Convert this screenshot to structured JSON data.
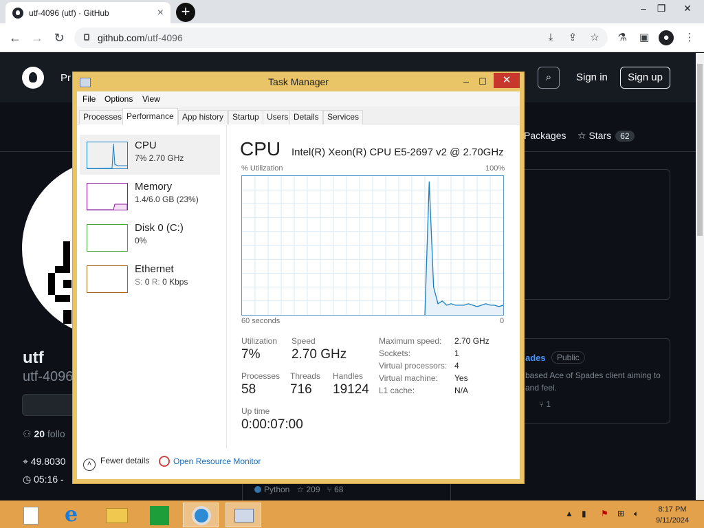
{
  "browser": {
    "tab_title": "utf-4096 (utf) · GitHub",
    "tab_close": "×",
    "new_tab": "+",
    "url_domain": "github.com",
    "url_path": "/utf-4096",
    "back": "←",
    "forward": "→",
    "reload": "↻"
  },
  "github": {
    "nav_partial": "Pr",
    "sign_in": "Sign in",
    "sign_up": "Sign up",
    "packages": "Packages",
    "stars_label": "Stars",
    "stars_count": "62",
    "name": "utf",
    "login": "utf-4096",
    "followers_count": "20",
    "followers_partial": "follo",
    "location_partial": "49.8030",
    "time_partial": "05:16 -",
    "repo_name_partial": "ades",
    "repo_visibility": "Public",
    "repo_desc_partial": "based Ace of Spades client aiming to and feel.",
    "repo_forks": "1",
    "lang": "Python",
    "lang_stars": "209",
    "lang_forks": "68",
    "accent": "#4493f8"
  },
  "tm": {
    "title": "Task Manager",
    "menu": [
      "File",
      "Options",
      "View"
    ],
    "tabs": [
      "Processes",
      "Performance",
      "App history",
      "Startup",
      "Users",
      "Details",
      "Services"
    ],
    "active_tab": "Performance",
    "resources": [
      {
        "name": "CPU",
        "sub": "7%  2.70 GHz",
        "color": "#1a7fc1"
      },
      {
        "name": "Memory",
        "sub": "1.4/6.0 GB (23%)",
        "color": "#8b1a9e"
      },
      {
        "name": "Disk 0 (C:)",
        "sub": "0%",
        "color": "#4da13e"
      },
      {
        "name": "Ethernet",
        "sub_s": "S:",
        "sub_s_val": "0",
        "sub_r": "R:",
        "sub_r_val": "0 Kbps",
        "color": "#a06a1a"
      }
    ],
    "cpu_title": "CPU",
    "cpu_model": "Intel(R) Xeon(R) CPU E5-2697 v2 @ 2.70GHz",
    "graph_label": "% Utilization",
    "graph_max": "100%",
    "graph_time": "60 seconds",
    "graph_zero": "0",
    "utilization_label": "Utilization",
    "utilization": "7%",
    "speed_label": "Speed",
    "speed": "2.70 GHz",
    "processes_label": "Processes",
    "processes": "58",
    "threads_label": "Threads",
    "threads": "716",
    "handles_label": "Handles",
    "handles": "19124",
    "uptime_label": "Up time",
    "uptime": "0:00:07:00",
    "kv": [
      {
        "k": "Maximum speed:",
        "v": "2.70 GHz"
      },
      {
        "k": "Sockets:",
        "v": "1"
      },
      {
        "k": "Virtual processors:",
        "v": "4"
      },
      {
        "k": "Virtual machine:",
        "v": "Yes"
      },
      {
        "k": "L1 cache:",
        "v": "N/A"
      }
    ],
    "fewer_details": "Fewer details",
    "open_resmon": "Open Resource Monitor"
  },
  "cpu_history_percent": [
    0,
    0,
    0,
    0,
    0,
    0,
    0,
    0,
    0,
    0,
    0,
    0,
    0,
    0,
    0,
    0,
    0,
    0,
    0,
    0,
    0,
    0,
    0,
    0,
    0,
    0,
    0,
    0,
    0,
    0,
    0,
    0,
    0,
    0,
    0,
    0,
    0,
    0,
    0,
    0,
    0,
    0,
    0,
    96,
    20,
    8,
    10,
    7,
    8,
    7,
    7,
    7,
    8,
    7,
    6,
    7,
    8,
    7,
    7,
    6,
    7
  ],
  "taskbar": {
    "time": "8:17 PM",
    "date": "9/11/2024"
  }
}
